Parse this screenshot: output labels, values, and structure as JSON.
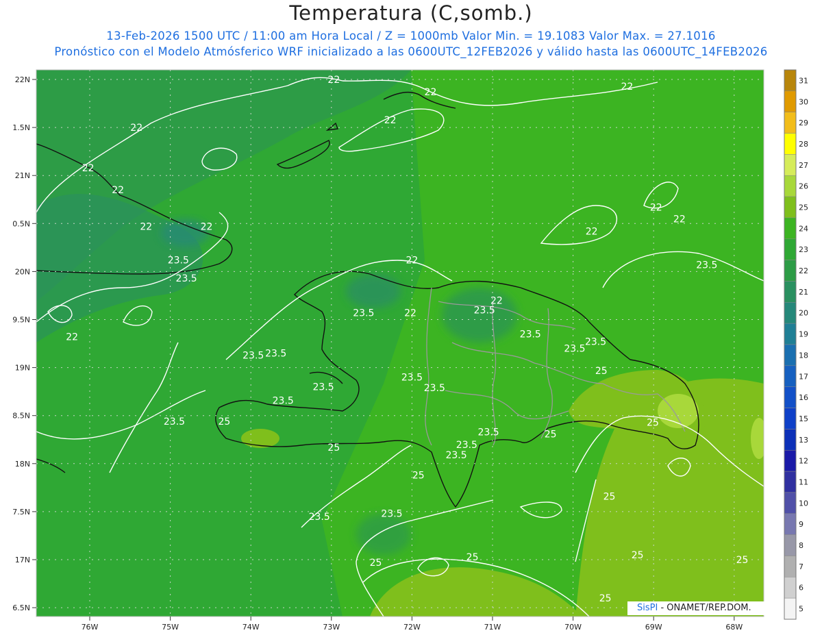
{
  "header": {
    "title": "Temperatura (C,somb.)",
    "subtitle1": "13-Feb-2026 1500 UTC / 11:00 am Hora Local / Z = 1000mb   Valor Min. = 19.1083  Valor Max. = 27.1016",
    "subtitle2": "Pronóstico con el Modelo Atmósferico WRF inicializado a las 0600UTC_12FEB2026 y válido hasta las  0600UTC_14FEB2026"
  },
  "axes": {
    "lat_labels": [
      "22N",
      "1.5N",
      "21N",
      "0.5N",
      "20N",
      "9.5N",
      "19N",
      "8.5N",
      "18N",
      "7.5N",
      "17N",
      "6.5N"
    ],
    "lon_labels": [
      "76W",
      "75W",
      "74W",
      "73W",
      "72W",
      "71W",
      "70W",
      "69W",
      "68W"
    ]
  },
  "colorbar": {
    "levels": [
      "31",
      "30",
      "29",
      "28",
      "27",
      "26",
      "25",
      "24",
      "23",
      "22",
      "21",
      "20",
      "19",
      "18",
      "17",
      "16",
      "15",
      "13",
      "12",
      "11",
      "10",
      "9",
      "8",
      "7",
      "6",
      "5"
    ],
    "colors": [
      "#b8860b",
      "#e09a00",
      "#f2bd1a",
      "#ffff00",
      "#d6ec5a",
      "#a8d83a",
      "#7fbf1c",
      "#3cb422",
      "#2fa834",
      "#2d9c46",
      "#2a9060",
      "#25887a",
      "#1f7f95",
      "#1a6fb0",
      "#1660c0",
      "#1250c8",
      "#0e40c8",
      "#0c30b8",
      "#1a1aa8",
      "#3030a0",
      "#5050a8",
      "#7878b0",
      "#9898a8",
      "#b0b0b0",
      "#d0d0d0",
      "#f4f4f4"
    ]
  },
  "contour_labels": [
    {
      "text": "22",
      "lon": -72.97,
      "lat": 22.0
    },
    {
      "text": "22",
      "lon": -72.27,
      "lat": 21.58
    },
    {
      "text": "22",
      "lon": -71.77,
      "lat": 21.87
    },
    {
      "text": "22",
      "lon": -69.33,
      "lat": 21.93
    },
    {
      "text": "22",
      "lon": -75.42,
      "lat": 21.5
    },
    {
      "text": "22",
      "lon": -76.02,
      "lat": 21.08
    },
    {
      "text": "22",
      "lon": -75.65,
      "lat": 20.85
    },
    {
      "text": "22",
      "lon": -75.3,
      "lat": 20.47
    },
    {
      "text": "22",
      "lon": -74.55,
      "lat": 20.47
    },
    {
      "text": "23.5",
      "lon": -74.9,
      "lat": 20.12
    },
    {
      "text": "23.5",
      "lon": -74.8,
      "lat": 19.93
    },
    {
      "text": "22",
      "lon": -76.22,
      "lat": 19.32
    },
    {
      "text": "22",
      "lon": -72.0,
      "lat": 20.12
    },
    {
      "text": "22",
      "lon": -72.02,
      "lat": 19.57
    },
    {
      "text": "23.5",
      "lon": -72.6,
      "lat": 19.57
    },
    {
      "text": "23.5",
      "lon": -71.1,
      "lat": 19.6
    },
    {
      "text": "22",
      "lon": -70.95,
      "lat": 19.7
    },
    {
      "text": "23.5",
      "lon": -70.53,
      "lat": 19.35
    },
    {
      "text": "23.5",
      "lon": -69.98,
      "lat": 19.2
    },
    {
      "text": "23.5",
      "lon": -69.72,
      "lat": 19.27
    },
    {
      "text": "22",
      "lon": -68.97,
      "lat": 20.67
    },
    {
      "text": "22",
      "lon": -68.68,
      "lat": 20.55
    },
    {
      "text": "22",
      "lon": -69.77,
      "lat": 20.42
    },
    {
      "text": "23.5",
      "lon": -68.34,
      "lat": 20.07
    },
    {
      "text": "23.5",
      "lon": -73.97,
      "lat": 19.13
    },
    {
      "text": "23.5",
      "lon": -73.69,
      "lat": 19.15
    },
    {
      "text": "23.5",
      "lon": -73.1,
      "lat": 18.8
    },
    {
      "text": "23.5",
      "lon": -73.6,
      "lat": 18.66
    },
    {
      "text": "23.5",
      "lon": -72.0,
      "lat": 18.9
    },
    {
      "text": "23.5",
      "lon": -71.72,
      "lat": 18.79
    },
    {
      "text": "25",
      "lon": -69.65,
      "lat": 18.97
    },
    {
      "text": "25",
      "lon": -74.33,
      "lat": 18.44
    },
    {
      "text": "25",
      "lon": -72.97,
      "lat": 18.17
    },
    {
      "text": "25",
      "lon": -69.01,
      "lat": 18.43
    },
    {
      "text": "23.5",
      "lon": -74.95,
      "lat": 18.44
    },
    {
      "text": "23.5",
      "lon": -71.05,
      "lat": 18.33
    },
    {
      "text": "23.5",
      "lon": -71.32,
      "lat": 18.2
    },
    {
      "text": "23.5",
      "lon": -71.45,
      "lat": 18.09
    },
    {
      "text": "25",
      "lon": -70.28,
      "lat": 18.31
    },
    {
      "text": "25",
      "lon": -71.92,
      "lat": 17.88
    },
    {
      "text": "25",
      "lon": -69.55,
      "lat": 17.66
    },
    {
      "text": "23.5",
      "lon": -73.15,
      "lat": 17.45
    },
    {
      "text": "23.5",
      "lon": -72.25,
      "lat": 17.48
    },
    {
      "text": "25",
      "lon": -71.25,
      "lat": 17.03
    },
    {
      "text": "25",
      "lon": -72.45,
      "lat": 16.97
    },
    {
      "text": "25",
      "lon": -69.2,
      "lat": 17.05
    },
    {
      "text": "25",
      "lon": -67.9,
      "lat": 17.0
    },
    {
      "text": "25",
      "lon": -69.6,
      "lat": 16.6
    }
  ],
  "credit": {
    "brand": "SisPI",
    "text": " - ONAMET/REP.DOM."
  }
}
